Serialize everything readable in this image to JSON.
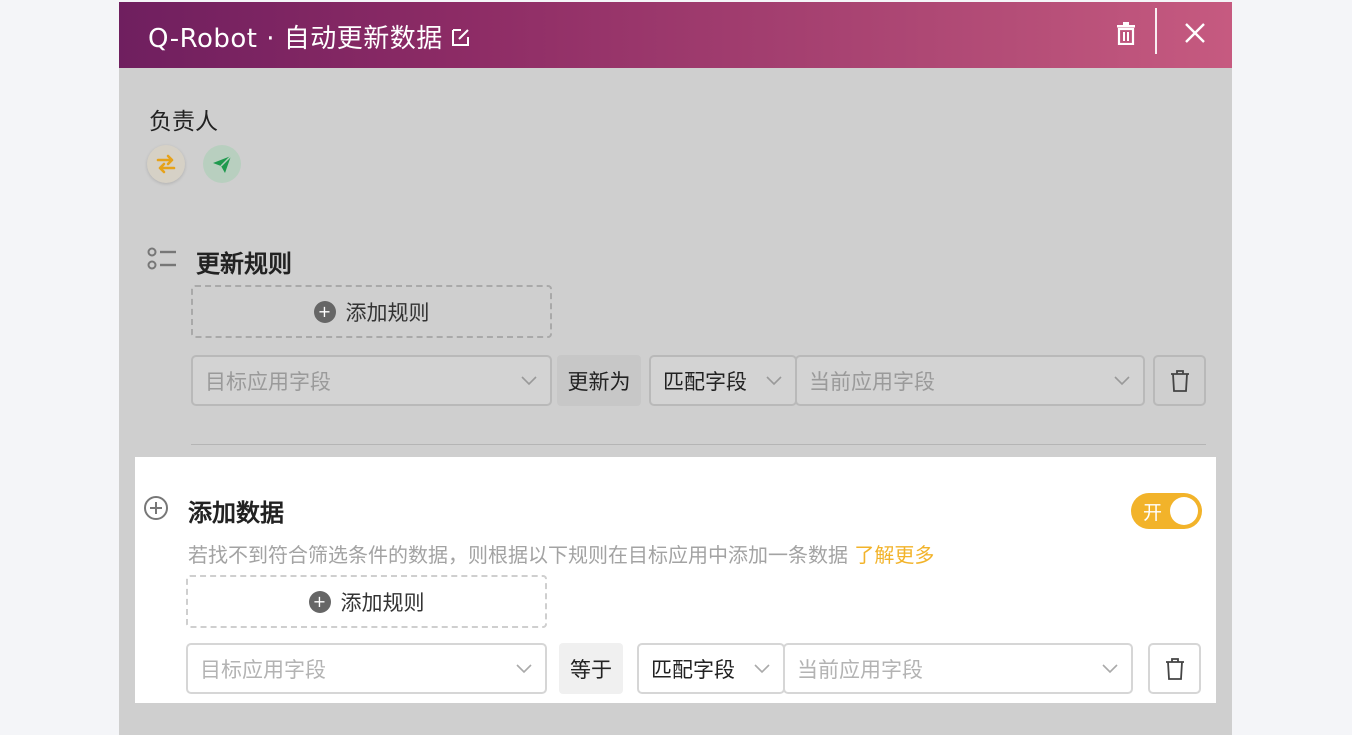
{
  "header": {
    "title": "Q-Robot · 自动更新数据"
  },
  "owner": {
    "label": "负责人"
  },
  "update_rules": {
    "title": "更新规则",
    "add_rule_label": "添加规则",
    "row": {
      "target_field_placeholder": "目标应用字段",
      "operator_label": "更新为",
      "match_type": "匹配字段",
      "current_field_placeholder": "当前应用字段"
    }
  },
  "add_data": {
    "title": "添加数据",
    "description": "若找不到符合筛选条件的数据，则根据以下规则在目标应用中添加一条数据",
    "learn_more": "了解更多",
    "toggle_label": "开",
    "toggle_on": true,
    "add_rule_label": "添加规则",
    "row": {
      "target_field_placeholder": "目标应用字段",
      "operator_label": "等于",
      "match_type": "匹配字段",
      "current_field_placeholder": "当前应用字段"
    }
  },
  "colors": {
    "header_start": "#6f1f5f",
    "header_end": "#c65a80",
    "accent": "#f2b32a",
    "link": "#f2b32a"
  }
}
